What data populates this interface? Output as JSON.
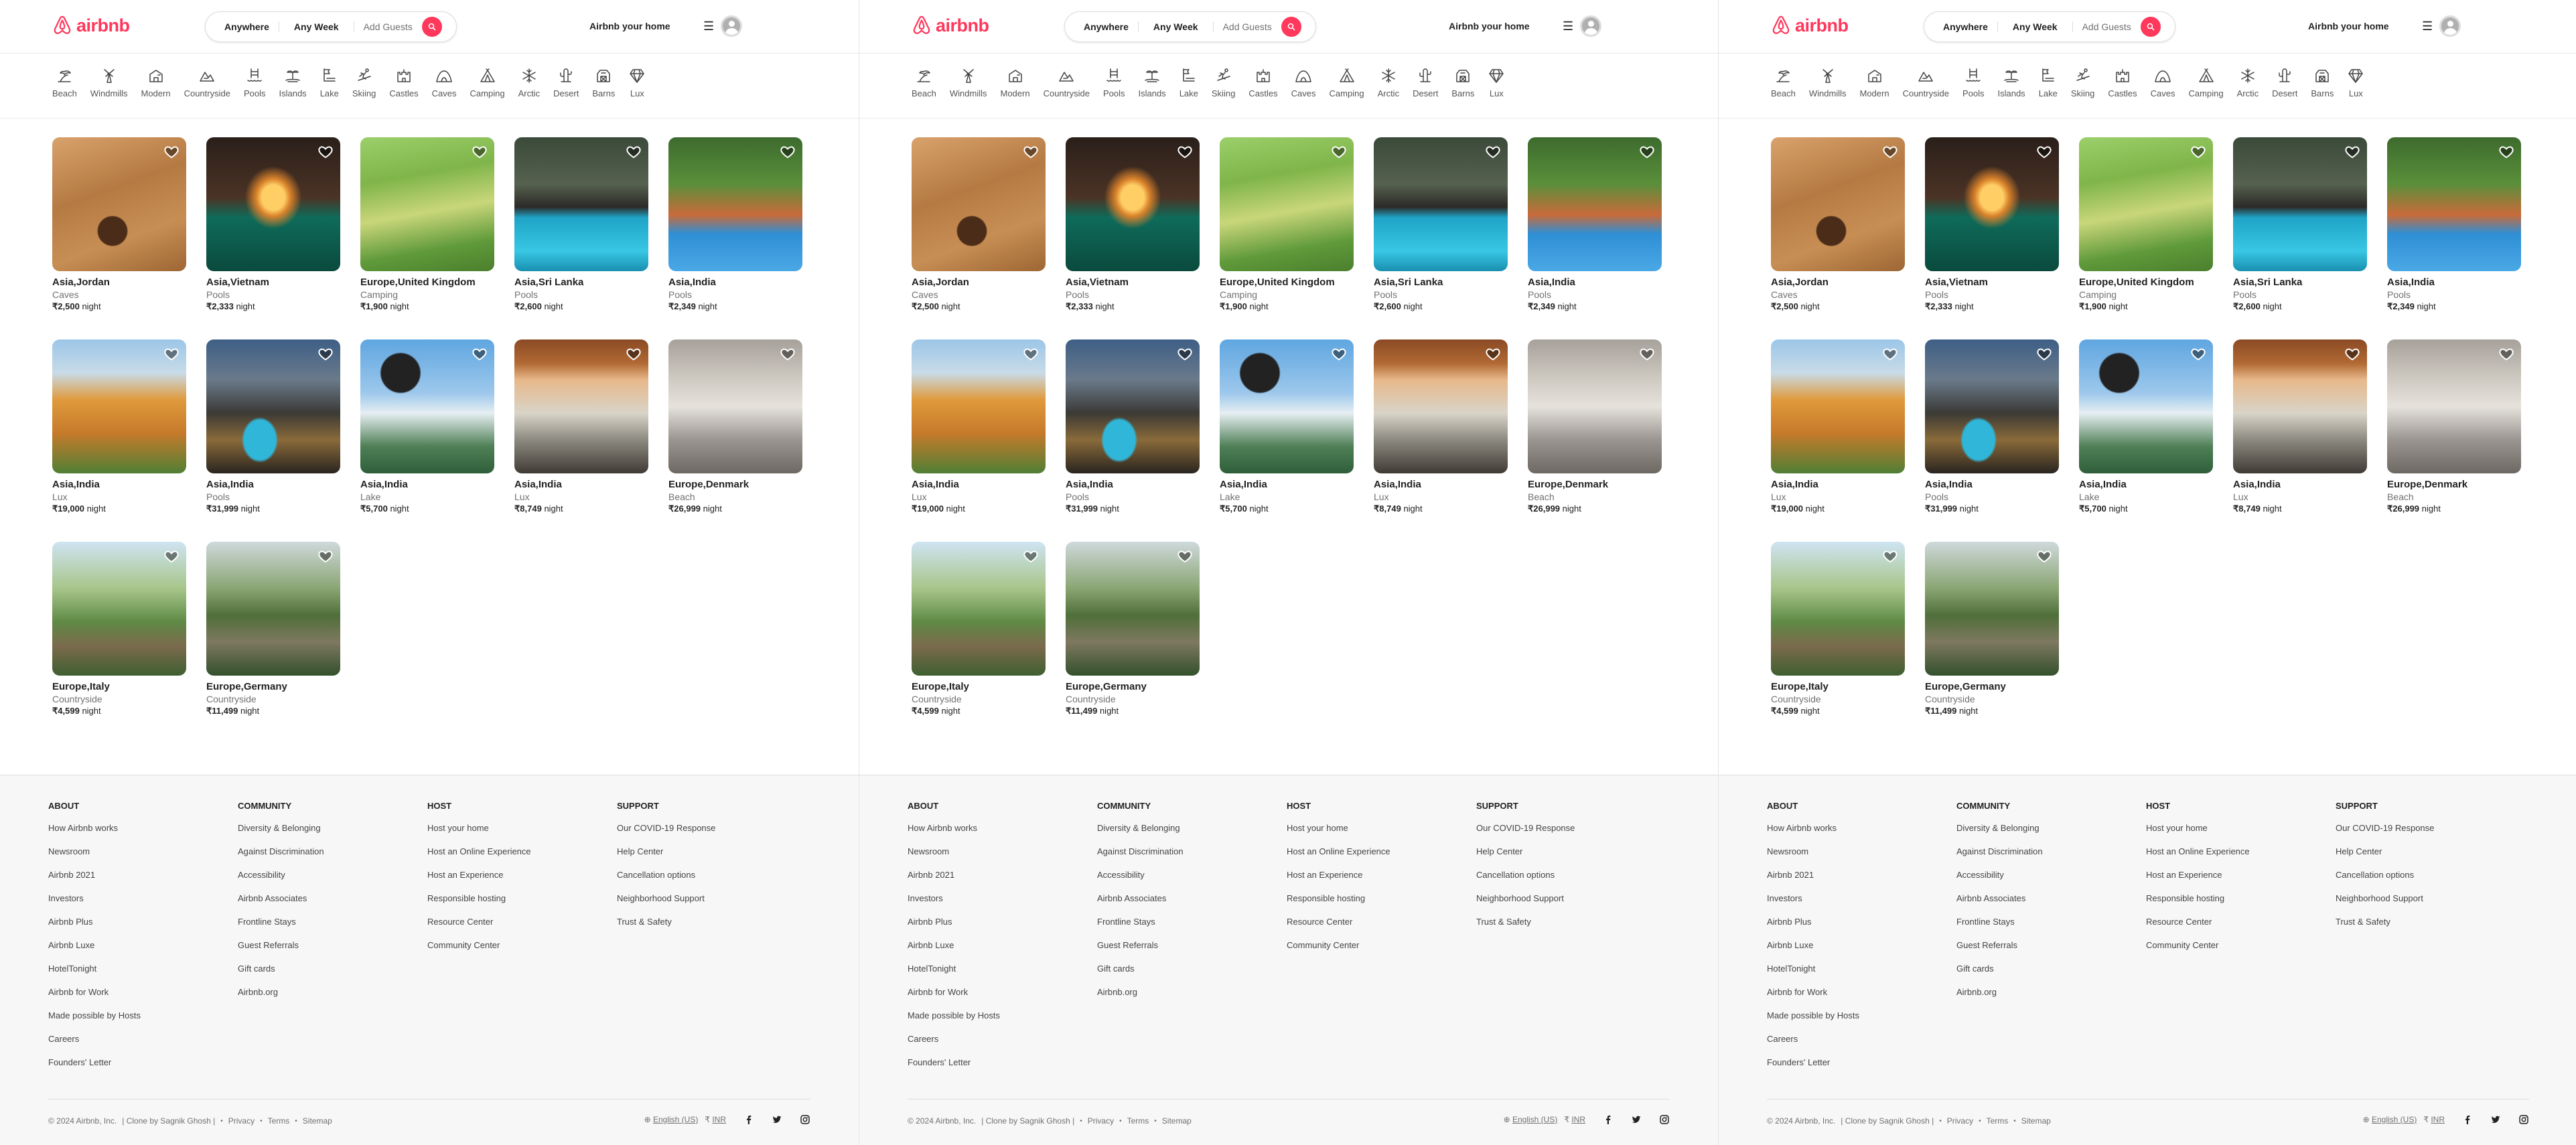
{
  "header": {
    "logo_text": "airbnb",
    "search": {
      "anywhere": "Anywhere",
      "any_week": "Any Week",
      "add_guests": "Add Guests"
    },
    "host_link": "Airbnb your home",
    "menu_icon": "hamburger-icon",
    "brand_color": "#ff385c"
  },
  "categories": [
    {
      "label": "Beach",
      "icon": "beach-icon"
    },
    {
      "label": "Windmills",
      "icon": "windmill-icon"
    },
    {
      "label": "Modern",
      "icon": "modern-house-icon"
    },
    {
      "label": "Countryside",
      "icon": "countryside-icon"
    },
    {
      "label": "Pools",
      "icon": "pool-icon"
    },
    {
      "label": "Islands",
      "icon": "island-icon"
    },
    {
      "label": "Lake",
      "icon": "lake-icon"
    },
    {
      "label": "Skiing",
      "icon": "skiing-icon"
    },
    {
      "label": "Castles",
      "icon": "castle-icon"
    },
    {
      "label": "Caves",
      "icon": "cave-icon"
    },
    {
      "label": "Camping",
      "icon": "camping-icon"
    },
    {
      "label": "Arctic",
      "icon": "snowflake-icon"
    },
    {
      "label": "Desert",
      "icon": "cactus-icon"
    },
    {
      "label": "Barns",
      "icon": "barn-icon"
    },
    {
      "label": "Lux",
      "icon": "diamond-icon"
    }
  ],
  "listings": [
    {
      "location": "Asia,Jordan",
      "category": "Caves",
      "price": "₹2,500",
      "unit": "night"
    },
    {
      "location": "Asia,Vietnam",
      "category": "Pools",
      "price": "₹2,333",
      "unit": "night"
    },
    {
      "location": "Europe,United Kingdom",
      "category": "Camping",
      "price": "₹1,900",
      "unit": "night"
    },
    {
      "location": "Asia,Sri Lanka",
      "category": "Pools",
      "price": "₹2,600",
      "unit": "night"
    },
    {
      "location": "Asia,India",
      "category": "Pools",
      "price": "₹2,349",
      "unit": "night"
    },
    {
      "location": "Asia,India",
      "category": "Lux",
      "price": "₹19,000",
      "unit": "night"
    },
    {
      "location": "Asia,India",
      "category": "Pools",
      "price": "₹31,999",
      "unit": "night"
    },
    {
      "location": "Asia,India",
      "category": "Lake",
      "price": "₹5,700",
      "unit": "night"
    },
    {
      "location": "Asia,India",
      "category": "Lux",
      "price": "₹8,749",
      "unit": "night"
    },
    {
      "location": "Europe,Denmark",
      "category": "Beach",
      "price": "₹26,999",
      "unit": "night"
    },
    {
      "location": "Europe,Italy",
      "category": "Countryside",
      "price": "₹4,599",
      "unit": "night"
    },
    {
      "location": "Europe,Germany",
      "category": "Countryside",
      "price": "₹11,499",
      "unit": "night"
    }
  ],
  "footer": {
    "columns": [
      {
        "title": "ABOUT",
        "links": [
          "How Airbnb works",
          "Newsroom",
          "Airbnb 2021",
          "Investors",
          "Airbnb Plus",
          "Airbnb Luxe",
          "HotelTonight",
          "Airbnb for Work",
          "Made possible by Hosts",
          "Careers",
          "Founders' Letter"
        ]
      },
      {
        "title": "COMMUNITY",
        "links": [
          "Diversity & Belonging",
          "Against Discrimination",
          "Accessibility",
          "Airbnb Associates",
          "Frontline Stays",
          "Guest Referrals",
          "Gift cards",
          "Airbnb.org"
        ]
      },
      {
        "title": "HOST",
        "links": [
          "Host your home",
          "Host an Online Experience",
          "Host an Experience",
          "Responsible hosting",
          "Resource Center",
          "Community Center"
        ]
      },
      {
        "title": "SUPPORT",
        "links": [
          "Our COVID-19 Response",
          "Help Center",
          "Cancellation options",
          "Neighborhood Support",
          "Trust & Safety"
        ]
      }
    ],
    "copyright": "© 2024 Airbnb, Inc.",
    "credit": "| Clone by Sagnik Ghosh |",
    "bottom_links": [
      "Privacy",
      "Terms",
      "Sitemap"
    ],
    "language": "English (US)",
    "currency_symbol": "₹",
    "currency": "INR",
    "social_icons": [
      "facebook-icon",
      "twitter-icon",
      "instagram-icon"
    ]
  }
}
